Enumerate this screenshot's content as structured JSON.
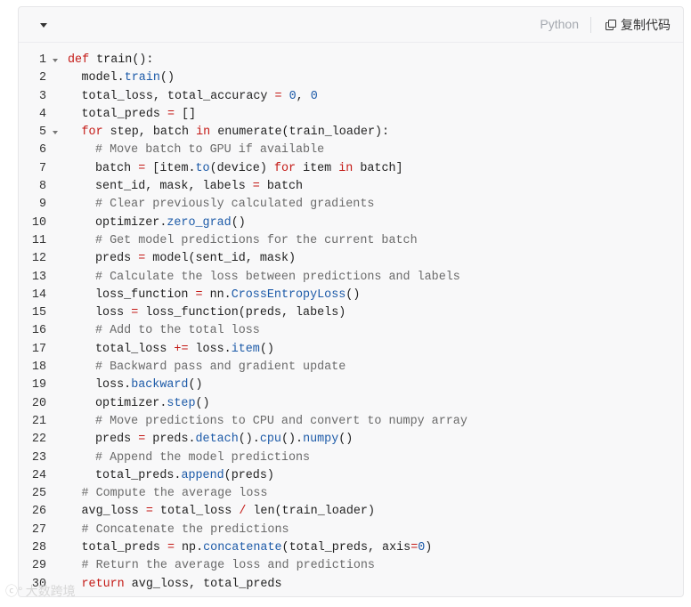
{
  "header": {
    "language": "Python",
    "copy_label": "复制代码"
  },
  "watermark": {
    "text": "大数跨境"
  },
  "colors": {
    "keyword": "#c41a16",
    "function": "#1c5aa8",
    "number": "#1c5aa8",
    "comment": "#6a6a6a",
    "text": "#222222"
  },
  "code_lines": [
    {
      "n": "1",
      "fold": true,
      "indent": 0,
      "tokens": [
        {
          "t": "kw",
          "v": "def"
        },
        {
          "t": "plain",
          "v": " train():"
        }
      ]
    },
    {
      "n": "2",
      "fold": false,
      "indent": 1,
      "tokens": [
        {
          "t": "plain",
          "v": "model."
        },
        {
          "t": "fn",
          "v": "train"
        },
        {
          "t": "plain",
          "v": "()"
        }
      ]
    },
    {
      "n": "3",
      "fold": false,
      "indent": 1,
      "tokens": [
        {
          "t": "plain",
          "v": "total_loss, total_accuracy "
        },
        {
          "t": "op",
          "v": "="
        },
        {
          "t": "plain",
          "v": " "
        },
        {
          "t": "num",
          "v": "0"
        },
        {
          "t": "plain",
          "v": ", "
        },
        {
          "t": "num",
          "v": "0"
        }
      ]
    },
    {
      "n": "4",
      "fold": false,
      "indent": 1,
      "tokens": [
        {
          "t": "plain",
          "v": "total_preds "
        },
        {
          "t": "op",
          "v": "="
        },
        {
          "t": "plain",
          "v": " []"
        }
      ]
    },
    {
      "n": "5",
      "fold": true,
      "indent": 1,
      "tokens": [
        {
          "t": "kw",
          "v": "for"
        },
        {
          "t": "plain",
          "v": " step, batch "
        },
        {
          "t": "kw",
          "v": "in"
        },
        {
          "t": "plain",
          "v": " enumerate(train_loader):"
        }
      ]
    },
    {
      "n": "6",
      "fold": false,
      "indent": 2,
      "tokens": [
        {
          "t": "cm",
          "v": "# Move batch to GPU if available"
        }
      ]
    },
    {
      "n": "7",
      "fold": false,
      "indent": 2,
      "tokens": [
        {
          "t": "plain",
          "v": "batch "
        },
        {
          "t": "op",
          "v": "="
        },
        {
          "t": "plain",
          "v": " [item."
        },
        {
          "t": "fn",
          "v": "to"
        },
        {
          "t": "plain",
          "v": "(device) "
        },
        {
          "t": "kw",
          "v": "for"
        },
        {
          "t": "plain",
          "v": " item "
        },
        {
          "t": "kw",
          "v": "in"
        },
        {
          "t": "plain",
          "v": " batch]"
        }
      ]
    },
    {
      "n": "8",
      "fold": false,
      "indent": 2,
      "tokens": [
        {
          "t": "plain",
          "v": "sent_id, mask, labels "
        },
        {
          "t": "op",
          "v": "="
        },
        {
          "t": "plain",
          "v": " batch"
        }
      ]
    },
    {
      "n": "9",
      "fold": false,
      "indent": 2,
      "tokens": [
        {
          "t": "cm",
          "v": "# Clear previously calculated gradients"
        }
      ]
    },
    {
      "n": "10",
      "fold": false,
      "indent": 2,
      "tokens": [
        {
          "t": "plain",
          "v": "optimizer."
        },
        {
          "t": "fn",
          "v": "zero_grad"
        },
        {
          "t": "plain",
          "v": "()"
        }
      ]
    },
    {
      "n": "11",
      "fold": false,
      "indent": 2,
      "tokens": [
        {
          "t": "cm",
          "v": "# Get model predictions for the current batch"
        }
      ]
    },
    {
      "n": "12",
      "fold": false,
      "indent": 2,
      "tokens": [
        {
          "t": "plain",
          "v": "preds "
        },
        {
          "t": "op",
          "v": "="
        },
        {
          "t": "plain",
          "v": " model(sent_id, mask)"
        }
      ]
    },
    {
      "n": "13",
      "fold": false,
      "indent": 2,
      "tokens": [
        {
          "t": "cm",
          "v": "# Calculate the loss between predictions and labels"
        }
      ]
    },
    {
      "n": "14",
      "fold": false,
      "indent": 2,
      "tokens": [
        {
          "t": "plain",
          "v": "loss_function "
        },
        {
          "t": "op",
          "v": "="
        },
        {
          "t": "plain",
          "v": " nn."
        },
        {
          "t": "fn",
          "v": "CrossEntropyLoss"
        },
        {
          "t": "plain",
          "v": "()"
        }
      ]
    },
    {
      "n": "15",
      "fold": false,
      "indent": 2,
      "tokens": [
        {
          "t": "plain",
          "v": "loss "
        },
        {
          "t": "op",
          "v": "="
        },
        {
          "t": "plain",
          "v": " loss_function(preds, labels)"
        }
      ]
    },
    {
      "n": "16",
      "fold": false,
      "indent": 2,
      "tokens": [
        {
          "t": "cm",
          "v": "# Add to the total loss"
        }
      ]
    },
    {
      "n": "17",
      "fold": false,
      "indent": 2,
      "tokens": [
        {
          "t": "plain",
          "v": "total_loss "
        },
        {
          "t": "op",
          "v": "+="
        },
        {
          "t": "plain",
          "v": " loss."
        },
        {
          "t": "fn",
          "v": "item"
        },
        {
          "t": "plain",
          "v": "()"
        }
      ]
    },
    {
      "n": "18",
      "fold": false,
      "indent": 2,
      "tokens": [
        {
          "t": "cm",
          "v": "# Backward pass and gradient update"
        }
      ]
    },
    {
      "n": "19",
      "fold": false,
      "indent": 2,
      "tokens": [
        {
          "t": "plain",
          "v": "loss."
        },
        {
          "t": "fn",
          "v": "backward"
        },
        {
          "t": "plain",
          "v": "()"
        }
      ]
    },
    {
      "n": "20",
      "fold": false,
      "indent": 2,
      "tokens": [
        {
          "t": "plain",
          "v": "optimizer."
        },
        {
          "t": "fn",
          "v": "step"
        },
        {
          "t": "plain",
          "v": "()"
        }
      ]
    },
    {
      "n": "21",
      "fold": false,
      "indent": 2,
      "tokens": [
        {
          "t": "cm",
          "v": "# Move predictions to CPU and convert to numpy array"
        }
      ]
    },
    {
      "n": "22",
      "fold": false,
      "indent": 2,
      "tokens": [
        {
          "t": "plain",
          "v": "preds "
        },
        {
          "t": "op",
          "v": "="
        },
        {
          "t": "plain",
          "v": " preds."
        },
        {
          "t": "fn",
          "v": "detach"
        },
        {
          "t": "plain",
          "v": "()."
        },
        {
          "t": "fn",
          "v": "cpu"
        },
        {
          "t": "plain",
          "v": "()."
        },
        {
          "t": "fn",
          "v": "numpy"
        },
        {
          "t": "plain",
          "v": "()"
        }
      ]
    },
    {
      "n": "23",
      "fold": false,
      "indent": 2,
      "tokens": [
        {
          "t": "cm",
          "v": "# Append the model predictions"
        }
      ]
    },
    {
      "n": "24",
      "fold": false,
      "indent": 2,
      "tokens": [
        {
          "t": "plain",
          "v": "total_preds."
        },
        {
          "t": "fn",
          "v": "append"
        },
        {
          "t": "plain",
          "v": "(preds)"
        }
      ]
    },
    {
      "n": "25",
      "fold": false,
      "indent": 1,
      "tokens": [
        {
          "t": "cm",
          "v": "# Compute the average loss"
        }
      ]
    },
    {
      "n": "26",
      "fold": false,
      "indent": 1,
      "tokens": [
        {
          "t": "plain",
          "v": "avg_loss "
        },
        {
          "t": "op",
          "v": "="
        },
        {
          "t": "plain",
          "v": " total_loss "
        },
        {
          "t": "op",
          "v": "/"
        },
        {
          "t": "plain",
          "v": " len(train_loader)"
        }
      ]
    },
    {
      "n": "27",
      "fold": false,
      "indent": 1,
      "tokens": [
        {
          "t": "cm",
          "v": "# Concatenate the predictions"
        }
      ]
    },
    {
      "n": "28",
      "fold": false,
      "indent": 1,
      "tokens": [
        {
          "t": "plain",
          "v": "total_preds "
        },
        {
          "t": "op",
          "v": "="
        },
        {
          "t": "plain",
          "v": " np."
        },
        {
          "t": "fn",
          "v": "concatenate"
        },
        {
          "t": "plain",
          "v": "(total_preds, axis"
        },
        {
          "t": "op",
          "v": "="
        },
        {
          "t": "num",
          "v": "0"
        },
        {
          "t": "plain",
          "v": ")"
        }
      ]
    },
    {
      "n": "29",
      "fold": false,
      "indent": 1,
      "tokens": [
        {
          "t": "cm",
          "v": "# Return the average loss and predictions"
        }
      ]
    },
    {
      "n": "30",
      "fold": false,
      "indent": 1,
      "tokens": [
        {
          "t": "kw",
          "v": "return"
        },
        {
          "t": "plain",
          "v": " avg_loss, total_preds"
        }
      ]
    }
  ]
}
